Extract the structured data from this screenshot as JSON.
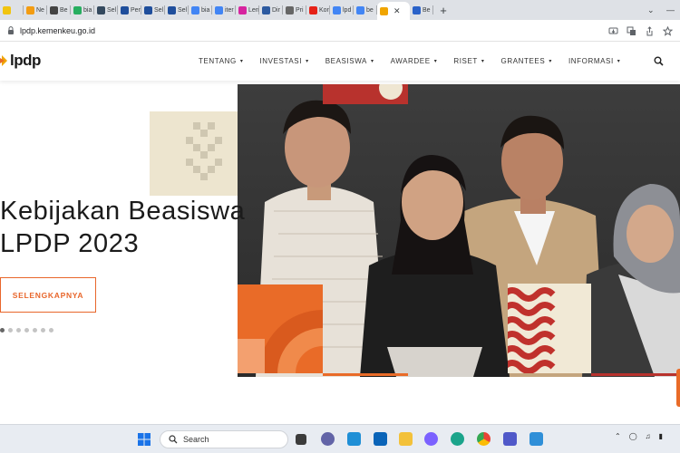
{
  "browser": {
    "tabs": [
      {
        "label": "",
        "favicon": "#f1c40f"
      },
      {
        "label": "Ne",
        "favicon": "#f39c12"
      },
      {
        "label": "Be",
        "favicon": "#444444"
      },
      {
        "label": "bia",
        "favicon": "#27ae60"
      },
      {
        "label": "Sel",
        "favicon": "#34495e"
      },
      {
        "label": "Per",
        "favicon": "#1f4e9c"
      },
      {
        "label": "Sel",
        "favicon": "#1f4e9c"
      },
      {
        "label": "Sel",
        "favicon": "#1f4e9c"
      },
      {
        "label": "bia",
        "favicon": "#4285f4"
      },
      {
        "label": "iter",
        "favicon": "#4285f4"
      },
      {
        "label": "Len",
        "favicon": "#d6249f"
      },
      {
        "label": "Dir",
        "favicon": "#2c5aa0"
      },
      {
        "label": "Pri",
        "favicon": "#666666"
      },
      {
        "label": "Kor",
        "favicon": "#e62117"
      },
      {
        "label": "lpd",
        "favicon": "#4285f4"
      },
      {
        "label": "be",
        "favicon": "#4285f4"
      }
    ],
    "active_tab": {
      "label": "",
      "favicon": "#f0a500"
    },
    "last_tab": {
      "label": "Be",
      "favicon": "#2a62c9"
    },
    "new_tab_label": "+",
    "url": "lpdp.kemenkeu.go.id"
  },
  "site": {
    "logo_text": "lpdp",
    "nav": [
      {
        "label": "TENTANG"
      },
      {
        "label": "INVESTASI"
      },
      {
        "label": "BEASISWA"
      },
      {
        "label": "AWARDEE"
      },
      {
        "label": "RISET"
      },
      {
        "label": "GRANTEES"
      },
      {
        "label": "INFORMASI"
      }
    ]
  },
  "hero": {
    "title_line1": "Kebijakan Beasiswa",
    "title_line2": "LPDP 2023",
    "button_label": "SELENGKAPNYA",
    "slide_count": 7,
    "active_slide": 1
  },
  "taskbar": {
    "search_label": "Search"
  },
  "colors": {
    "accent_orange": "#e96b28",
    "accent_red": "#b8322d",
    "cream": "#ede5cf"
  }
}
